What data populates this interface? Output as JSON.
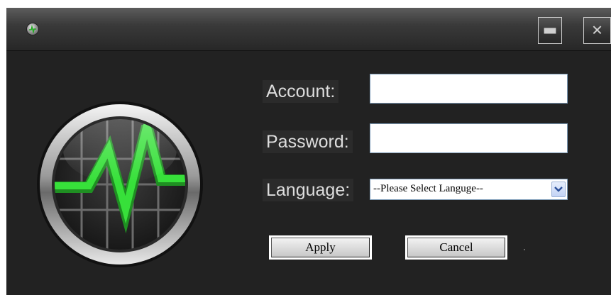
{
  "window": {
    "icon": "pulse-app-icon",
    "controls": {
      "minimize_icon": "minimize-icon",
      "close_icon": "close-icon"
    }
  },
  "form": {
    "account_label": "Account:",
    "account_value": "",
    "password_label": "Password:",
    "password_value": "",
    "language_label": "Language:",
    "language_selected": "--Please Select Languge--",
    "apply_label": "Apply",
    "cancel_label": "Cancel"
  },
  "colors": {
    "window_bg": "#222222",
    "label_text": "#dddddd",
    "logo_accent": "#37e03a"
  },
  "logo_icon": "heartbeat-monitor-icon"
}
